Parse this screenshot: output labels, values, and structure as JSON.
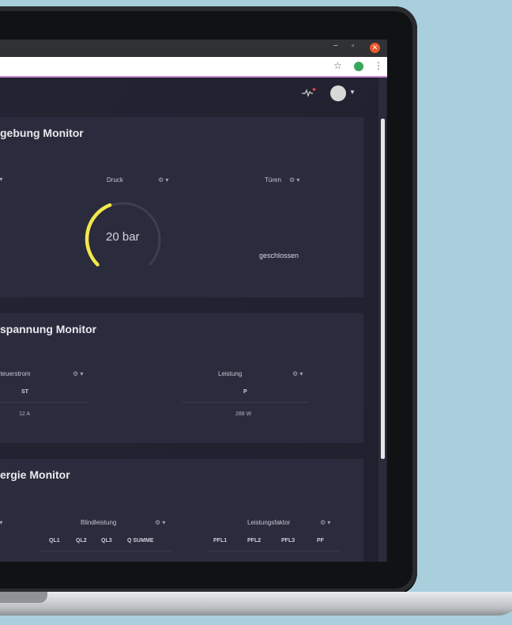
{
  "browser": {
    "window_controls": {
      "minimize": "–",
      "maximize": "▫",
      "close": "✕"
    }
  },
  "panels": {
    "umgebung": {
      "title": "gebung Monitor",
      "left_gear": "⚙ ▾",
      "druck": {
        "label": "Druck",
        "gear": "⚙ ▾",
        "value": "20 bar",
        "gauge_fraction": 0.42,
        "gauge_color": "#f3e84b"
      },
      "tueren": {
        "label": "Türen",
        "gear": "⚙ ▾",
        "value": "geschlossen"
      }
    },
    "spannung": {
      "title": "spannung Monitor",
      "steuerstrom": {
        "label": "Steuerstrom",
        "gear": "⚙ ▾",
        "column": "ST",
        "value": "12 A"
      },
      "leistung": {
        "label": "Leistung",
        "gear": "⚙ ▾",
        "column": "P",
        "value": "288 W"
      }
    },
    "energie": {
      "title": "ergie Monitor",
      "left_gear": "⚙ ▾",
      "blindleistung": {
        "label": "Blindleistung",
        "gear": "⚙ ▾",
        "columns": [
          "QL1",
          "QL2",
          "QL3",
          "Q SUMME"
        ]
      },
      "leistungsfaktor": {
        "label": "Leistungsfaktor",
        "gear": "⚙ ▾",
        "columns": [
          "PFL1",
          "PFL2",
          "PFL3",
          "PF"
        ]
      }
    }
  },
  "colors": {
    "accent_gauge": "#f3e84b",
    "notification_dot": "#e5484d"
  }
}
